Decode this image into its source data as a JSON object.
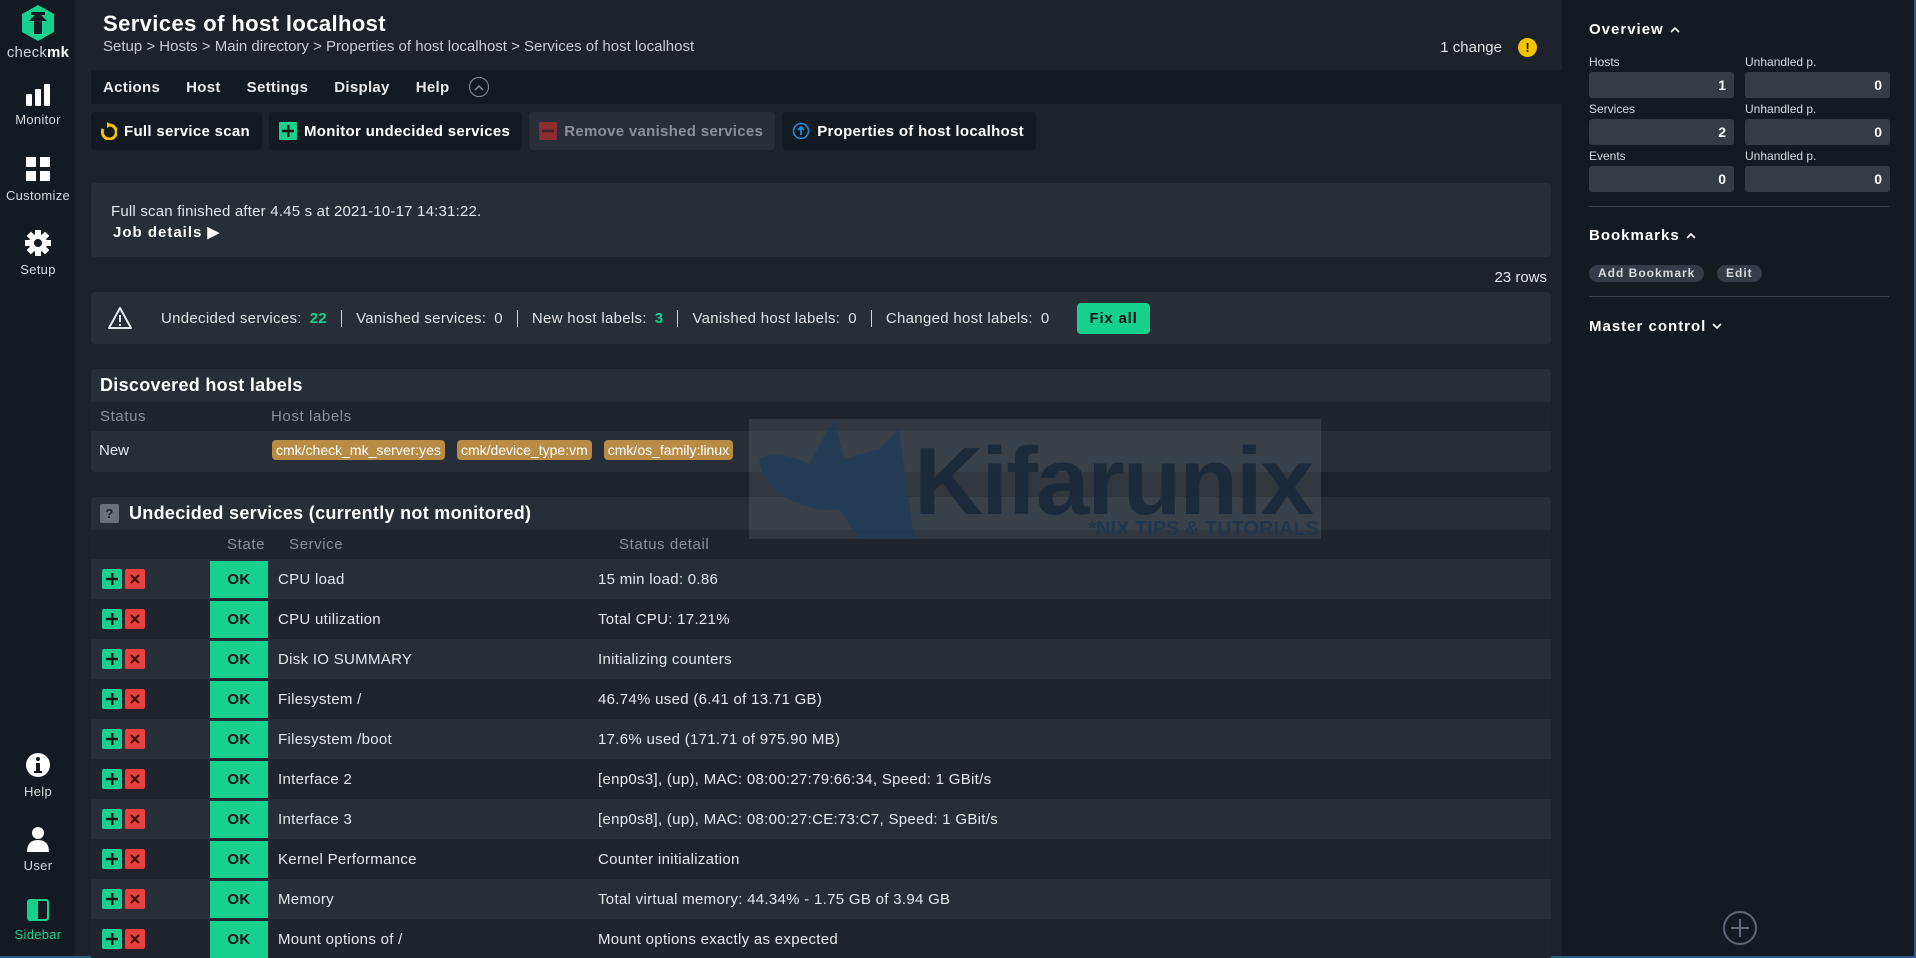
{
  "app": {
    "logo_prefix": "check",
    "logo_suffix": "mk",
    "brand_color": "#15d18d"
  },
  "leftnav": {
    "items": [
      {
        "label": "Monitor",
        "icon": "monitor-bars-icon"
      },
      {
        "label": "Customize",
        "icon": "customize-grid-icon"
      },
      {
        "label": "Setup",
        "icon": "gear-icon"
      },
      {
        "label": "Help",
        "icon": "info-icon"
      },
      {
        "label": "User",
        "icon": "user-icon"
      },
      {
        "label": "Sidebar",
        "icon": "sidebar-toggle-icon"
      }
    ]
  },
  "header": {
    "title": "Services of host localhost",
    "breadcrumb": "Setup > Hosts > Main directory > Properties of host localhost > Services of host localhost",
    "changes_label": "1 change",
    "changes_badge": "!"
  },
  "menubar": {
    "items": [
      "Actions",
      "Host",
      "Settings",
      "Display",
      "Help"
    ]
  },
  "toolbar": {
    "buttons": [
      {
        "label": "Full service scan",
        "icon": "refresh-icon",
        "enabled": true
      },
      {
        "label": "Monitor undecided services",
        "icon": "plus-icon",
        "enabled": true
      },
      {
        "label": "Remove vanished services",
        "icon": "minus-icon",
        "enabled": false
      },
      {
        "label": "Properties of host localhost",
        "icon": "up-arrow-circle-icon",
        "enabled": true
      }
    ]
  },
  "message": {
    "text": "Full scan finished after 4.45 s at 2021-10-17 14:31:22.",
    "job_details": "Job details ▶"
  },
  "rows_count": "23 rows",
  "summary": {
    "items": [
      {
        "label": "Undecided services:",
        "value": "22",
        "highlight": true
      },
      {
        "label": "Vanished services:",
        "value": "0",
        "highlight": false
      },
      {
        "label": "New host labels:",
        "value": "3",
        "highlight": true
      },
      {
        "label": "Vanished host labels:",
        "value": "0",
        "highlight": false
      },
      {
        "label": "Changed host labels:",
        "value": "0",
        "highlight": false
      }
    ],
    "fix_all": "Fix all"
  },
  "host_labels": {
    "title": "Discovered host labels",
    "columns": [
      "Status",
      "Host labels"
    ],
    "status": "New",
    "labels": [
      "cmk/check_mk_server:yes",
      "cmk/device_type:vm",
      "cmk/os_family:linux"
    ]
  },
  "undecided": {
    "title": "Undecided services (currently not monitored)",
    "help_badge": "?",
    "columns": [
      "State",
      "Service",
      "Status detail"
    ],
    "rows": [
      {
        "state": "OK",
        "service": "CPU load",
        "detail": "15 min load: 0.86"
      },
      {
        "state": "OK",
        "service": "CPU utilization",
        "detail": "Total CPU: 17.21%"
      },
      {
        "state": "OK",
        "service": "Disk IO SUMMARY",
        "detail": "Initializing counters"
      },
      {
        "state": "OK",
        "service": "Filesystem /",
        "detail": "46.74% used (6.41 of 13.71 GB)"
      },
      {
        "state": "OK",
        "service": "Filesystem /boot",
        "detail": "17.6% used (171.71 of 975.90 MB)"
      },
      {
        "state": "OK",
        "service": "Interface 2",
        "detail": "[enp0s3], (up), MAC: 08:00:27:79:66:34, Speed: 1 GBit/s"
      },
      {
        "state": "OK",
        "service": "Interface 3",
        "detail": "[enp0s8], (up), MAC: 08:00:27:CE:73:C7, Speed: 1 GBit/s"
      },
      {
        "state": "OK",
        "service": "Kernel Performance",
        "detail": "Counter initialization"
      },
      {
        "state": "OK",
        "service": "Memory",
        "detail": "Total virtual memory: 44.34% - 1.75 GB of 3.94 GB"
      },
      {
        "state": "OK",
        "service": "Mount options of /",
        "detail": "Mount options exactly as expected"
      }
    ]
  },
  "watermark": {
    "text": "Kifarunix",
    "subtext": "*NIX TIPS & TUTORIALS"
  },
  "sidebar": {
    "overview": {
      "title": "Overview",
      "cells": [
        {
          "label": "Hosts",
          "value": "1"
        },
        {
          "label": "Unhandled p.",
          "value": "0"
        },
        {
          "label": "Services",
          "value": "2"
        },
        {
          "label": "Unhandled p.",
          "value": "0"
        },
        {
          "label": "Events",
          "value": "0"
        },
        {
          "label": "Unhandled p.",
          "value": "0"
        }
      ]
    },
    "bookmarks": {
      "title": "Bookmarks",
      "add": "Add Bookmark",
      "edit": "Edit"
    },
    "master_control": {
      "title": "Master control"
    }
  }
}
